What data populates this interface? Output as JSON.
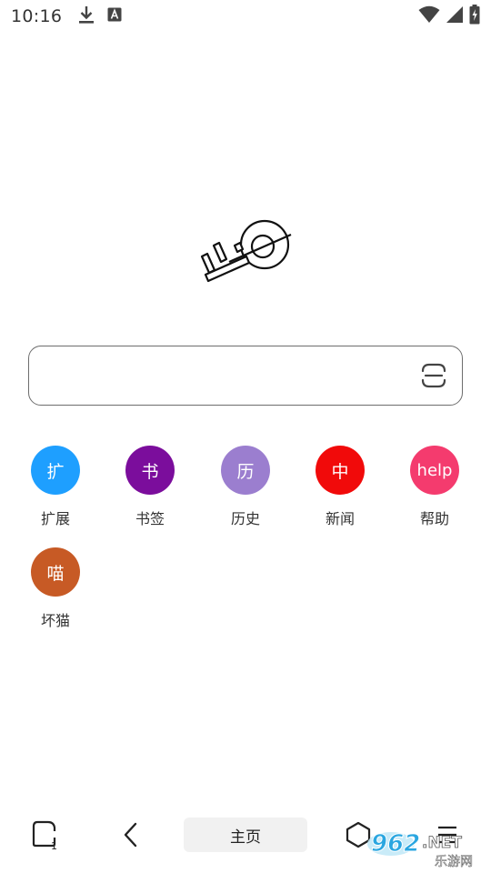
{
  "status_bar": {
    "time": "10:16",
    "icons": [
      "download-icon",
      "font-a-icon",
      "wifi-icon",
      "signal-icon",
      "battery-charging-icon"
    ]
  },
  "logo": {
    "icon": "key-logo-icon"
  },
  "search": {
    "value": "",
    "placeholder": "",
    "scan_icon": "scan-icon"
  },
  "shortcuts": [
    {
      "glyph": "扩",
      "label": "扩展",
      "color": "#1E9FFF"
    },
    {
      "glyph": "书",
      "label": "书签",
      "color": "#7B0D9C"
    },
    {
      "glyph": "历",
      "label": "历史",
      "color": "#9B7ECF"
    },
    {
      "glyph": "中",
      "label": "新闻",
      "color": "#F10A0A"
    },
    {
      "glyph": "help",
      "label": "帮助",
      "color": "#F43B6E"
    },
    {
      "glyph": "喵",
      "label": "坏猫",
      "color": "#C75A25"
    }
  ],
  "bottom_nav": {
    "tabs_count": "1",
    "home_label": "主页",
    "icons": [
      "tabs-icon",
      "back-icon",
      "shield-icon",
      "menu-icon"
    ]
  },
  "watermark": {
    "brand": "962",
    "suffix": ".NET",
    "subtitle": "乐游网"
  }
}
